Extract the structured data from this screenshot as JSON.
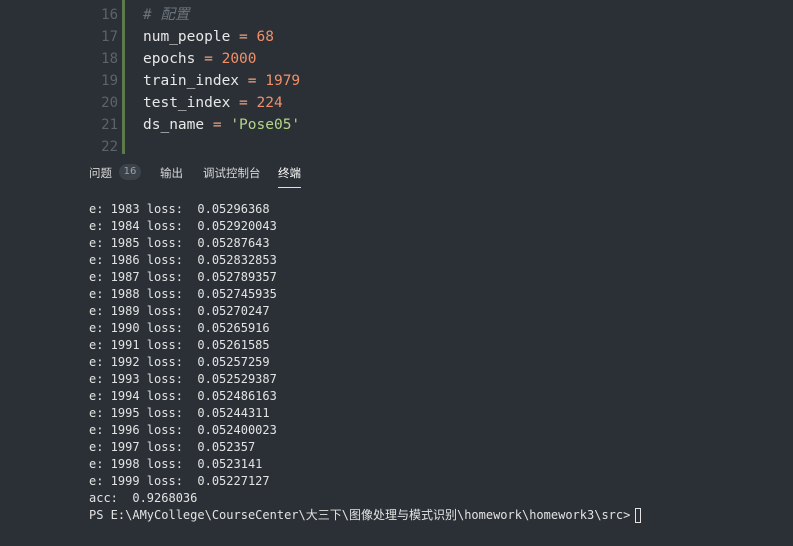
{
  "editor": {
    "line_numbers": [
      "16",
      "17",
      "18",
      "19",
      "20",
      "21",
      "22"
    ],
    "lines": [
      {
        "comment": "# 配置"
      },
      {
        "name": "num_people",
        "op": "=",
        "value": "68"
      },
      {
        "name": "epochs",
        "op": "=",
        "value": "2000"
      },
      {
        "name": "train_index",
        "op": "=",
        "value": "1979"
      },
      {
        "name": "test_index",
        "op": "=",
        "value": "224"
      },
      {
        "name": "ds_name",
        "op": "=",
        "value": "'Pose05'"
      }
    ]
  },
  "panel": {
    "tabs": [
      {
        "label": "问题"
      },
      {
        "label": "输出"
      },
      {
        "label": "调试控制台"
      },
      {
        "label": "终端"
      }
    ],
    "problems_count": "16"
  },
  "terminal": {
    "lines": [
      "e: 1983 loss:  0.05296368",
      "e: 1984 loss:  0.052920043",
      "e: 1985 loss:  0.05287643",
      "e: 1986 loss:  0.052832853",
      "e: 1987 loss:  0.052789357",
      "e: 1988 loss:  0.052745935",
      "e: 1989 loss:  0.05270247",
      "e: 1990 loss:  0.05265916",
      "e: 1991 loss:  0.05261585",
      "e: 1992 loss:  0.05257259",
      "e: 1993 loss:  0.052529387",
      "e: 1994 loss:  0.052486163",
      "e: 1995 loss:  0.05244311",
      "e: 1996 loss:  0.052400023",
      "e: 1997 loss:  0.052357",
      "e: 1998 loss:  0.0523141",
      "e: 1999 loss:  0.05227127",
      "acc:  0.9268036"
    ],
    "prompt": "PS E:\\AMyCollege\\CourseCenter\\大三下\\图像处理与模式识别\\homework\\homework3\\src>"
  },
  "colors": {
    "background": "#2b3036",
    "number": "#f0906a",
    "string": "#b5d58a",
    "indent_guide": "#5c7a4a"
  }
}
